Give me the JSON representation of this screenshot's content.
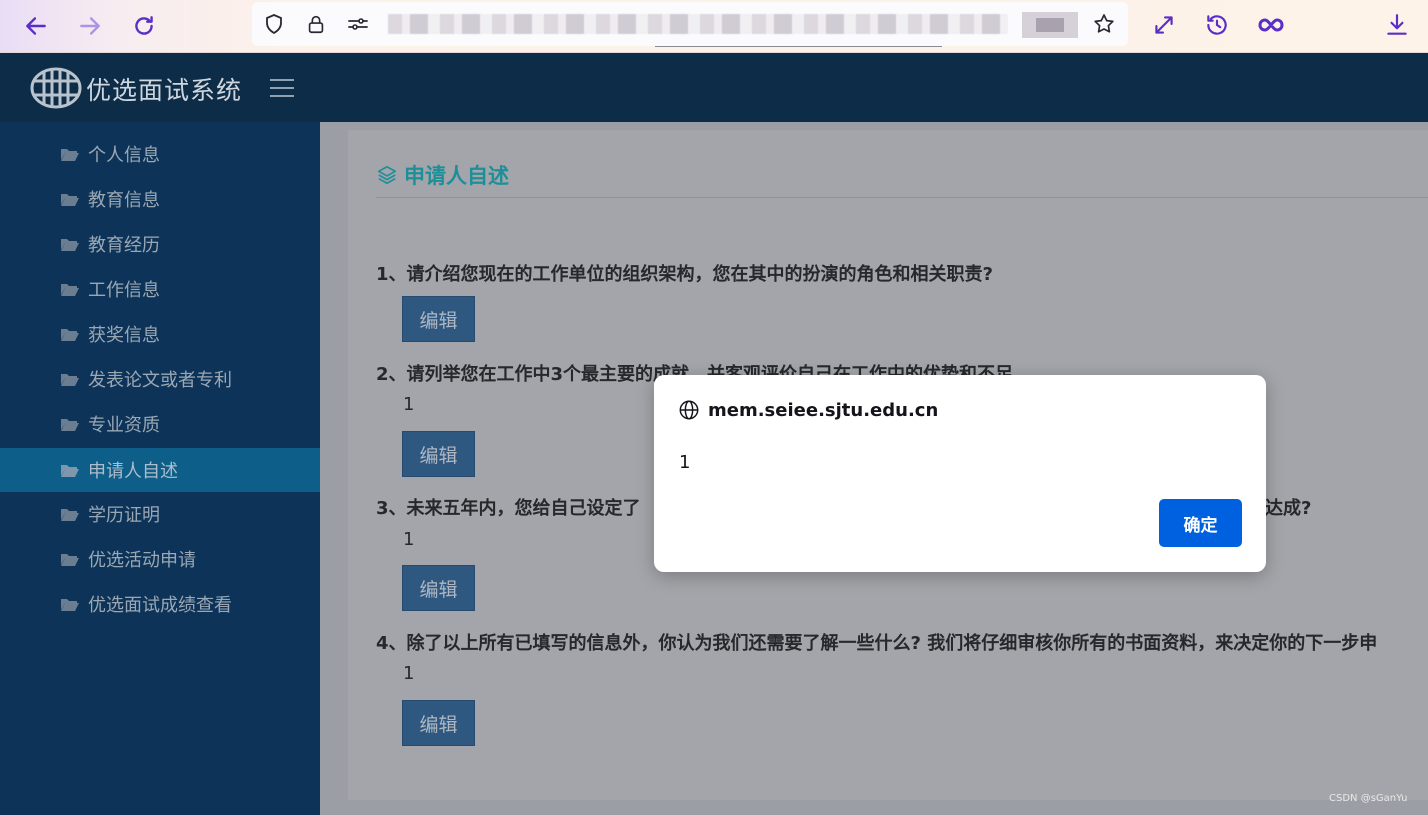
{
  "browser": {
    "accent_color": "#5b2ec7",
    "icons": [
      "back-arrow-icon",
      "forward-arrow-icon",
      "reload-icon",
      "shield-icon",
      "lock-icon",
      "permissions-icon",
      "bookmark-star-icon",
      "fullscreen-icon",
      "history-icon",
      "infinity-icon",
      "download-icon"
    ]
  },
  "app": {
    "title": "优选面试系统",
    "header_color": "#0d2c47"
  },
  "sidebar": {
    "items": [
      {
        "label": "个人信息",
        "active": false
      },
      {
        "label": "教育信息",
        "active": false
      },
      {
        "label": "教育经历",
        "active": false
      },
      {
        "label": "工作信息",
        "active": false
      },
      {
        "label": "获奖信息",
        "active": false
      },
      {
        "label": "发表论文或者专利",
        "active": false
      },
      {
        "label": "专业资质",
        "active": false
      },
      {
        "label": "申请人自述",
        "active": true
      },
      {
        "label": "学历证明",
        "active": false
      },
      {
        "label": "优选活动申请",
        "active": false
      },
      {
        "label": "优选面试成绩查看",
        "active": false
      }
    ]
  },
  "main": {
    "heading": "申请人自述",
    "questions": [
      {
        "text": "1、请介绍您现在的工作单位的组织架构，您在其中的扮演的角色和相关职责?",
        "answer": "",
        "edit_label": "编辑"
      },
      {
        "text": "2、请列举您在工作中3个最主要的成就，并客观评价自己在工作中的优势和不足。",
        "answer": "1",
        "edit_label": "编辑"
      },
      {
        "text": "3、未来五年内，您给自己设定了",
        "text_tail": "达成?",
        "answer": "1",
        "edit_label": "编辑"
      },
      {
        "text": "4、除了以上所有已填写的信息外，你认为我们还需要了解一些什么? 我们将仔细审核你所有的书面资料，来决定你的下一步申",
        "answer": "1",
        "edit_label": "编辑"
      }
    ]
  },
  "dialog": {
    "origin": "mem.seiee.sjtu.edu.cn",
    "message": "1",
    "ok_label": "确定",
    "ok_color": "#0061e0"
  },
  "watermark": "CSDN @sGanYu"
}
